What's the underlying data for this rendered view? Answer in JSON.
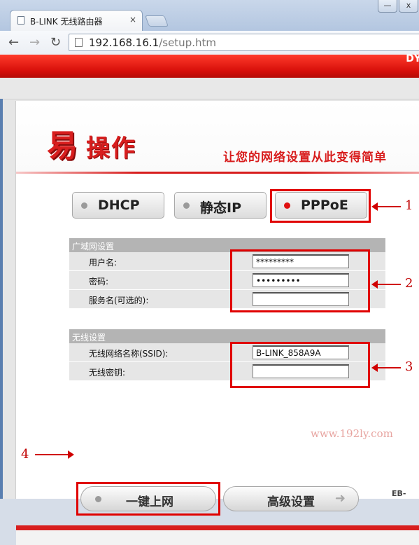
{
  "browser": {
    "tab_title": "B-LINK 无线路由器",
    "url_host": "192.168.16.1",
    "url_path": "/setup.htm",
    "controls": {
      "minimize": "—",
      "close": "x",
      "tab_close": "×"
    }
  },
  "router": {
    "banner_text": "DY",
    "logo_yi": "易",
    "logo_rest": "操作",
    "slogan": "让您的网络设置从此变得简单",
    "modes": [
      "DHCP",
      "静态IP",
      "PPPoE"
    ],
    "selected_mode": "PPPoE",
    "wan": {
      "heading": "广域网设置",
      "username_label": "用户名:",
      "username_value": "*********",
      "password_label": "密码:",
      "password_value": "•••••••••",
      "service_label": "服务名(可选的):",
      "service_value": ""
    },
    "wireless": {
      "heading": "无线设置",
      "ssid_label": "无线网络名称(SSID):",
      "ssid_value": "B-LINK_858A9A",
      "key_label": "无线密钥:",
      "key_value": ""
    },
    "one_click_label": "一键上网",
    "advanced_label": "高级设置",
    "advanced_icon": "arrow-right-icon",
    "accent_color": "#d81e1e",
    "highlight_color": "#e00000"
  },
  "annotations": [
    "1",
    "2",
    "3",
    "4"
  ],
  "watermark": "www.192ly.com",
  "corner_logo": "ЕВ-"
}
